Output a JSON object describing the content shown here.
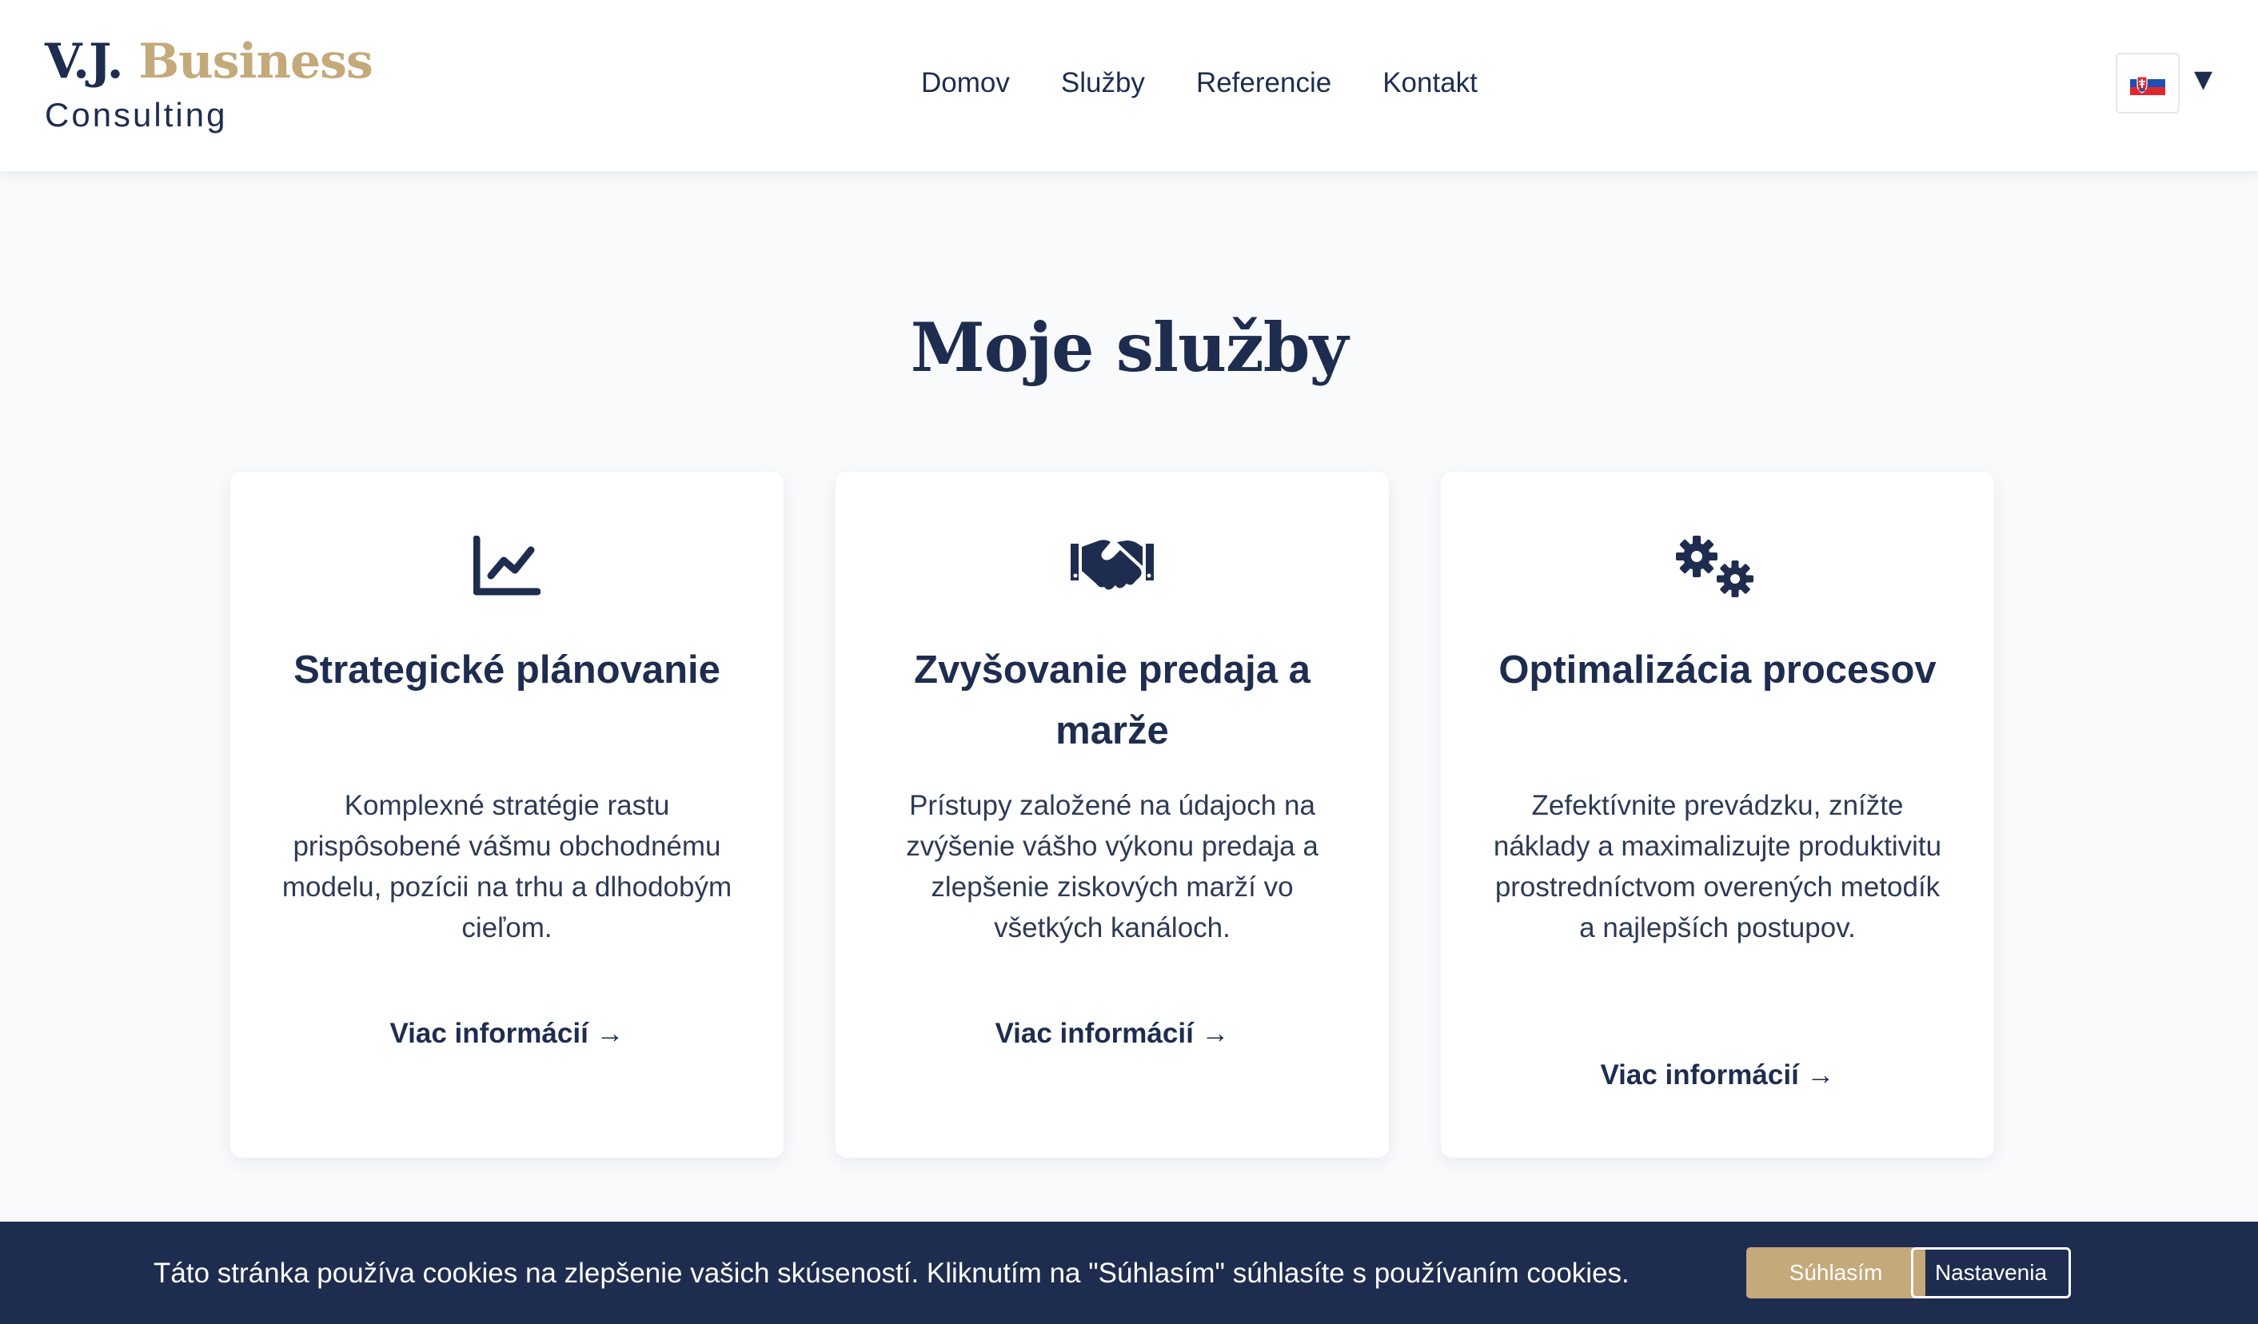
{
  "header": {
    "logo_part1": "V.J.",
    "logo_part2": "Business",
    "logo_subtitle": "Consulting",
    "nav": [
      "Domov",
      "Služby",
      "Referencie",
      "Kontakt"
    ],
    "language_flag": "slovak-flag-icon"
  },
  "main": {
    "section_title": "Moje služby",
    "cards": [
      {
        "icon": "chart-line-icon",
        "title": "Strategické plánovanie",
        "description": "Komplexné stratégie rastu prispôsobené vášmu obchodnému modelu, pozícii na trhu a dlhodobým cieľom.",
        "link": "Viac informácií →"
      },
      {
        "icon": "handshake-icon",
        "title": "Zvyšovanie predaja a marže",
        "description": "Prístupy založené na údajoch na zvýšenie vášho výkonu predaja a zlepšenie ziskových marží vo všetkých kanáloch.",
        "link": "Viac informácií →"
      },
      {
        "icon": "gears-icon",
        "title": "Optimalizácia procesov",
        "description": "Zefektívnite prevádzku, znížte náklady a maximalizujte produktivitu prostredníctvom overených metodík a najlepších postupov.",
        "link": "Viac informácií →"
      }
    ]
  },
  "cookie_banner": {
    "text": "Táto stránka používa cookies na zlepšenie vašich skúseností. Kliknutím na \"Súhlasím\" súhlasíte s používaním cookies.",
    "accept_label": "Súhlasím",
    "settings_label": "Nastavenia"
  },
  "colors": {
    "navy": "#1e2d4f",
    "gold": "#c4a97a",
    "background": "#f8fafc"
  }
}
